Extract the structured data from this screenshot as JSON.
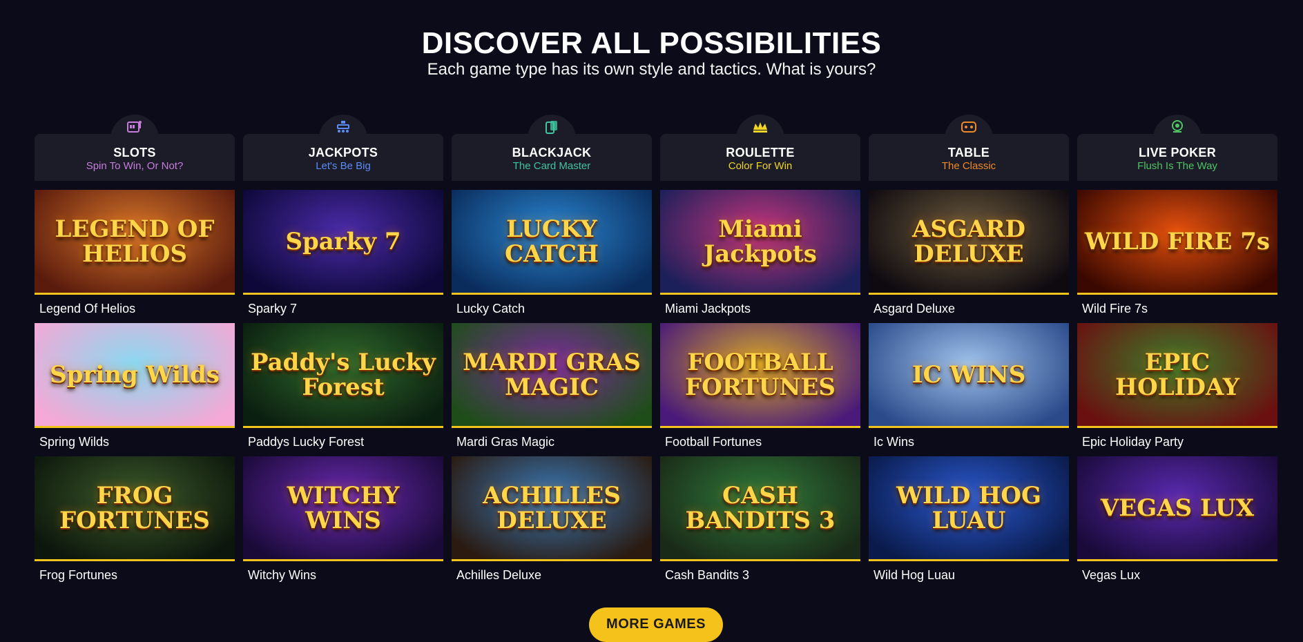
{
  "hero": {
    "title": "DISCOVER ALL POSSIBILITIES",
    "subtitle": "Each game type has its own style and tactics. What is yours?"
  },
  "categories": [
    {
      "title": "SLOTS",
      "subtitle": "Spin To Win, Or Not?",
      "icon": "slot-machine-icon",
      "color": "#c77ddc"
    },
    {
      "title": "JACKPOTS",
      "subtitle": "Let's Be Big",
      "icon": "jackpot-icon",
      "color": "#5b8cf5"
    },
    {
      "title": "BLACKJACK",
      "subtitle": "The Card Master",
      "icon": "cards-icon",
      "color": "#3fc5a0"
    },
    {
      "title": "ROULETTE",
      "subtitle": "Color For Win",
      "icon": "crown-icon",
      "color": "#f1d524"
    },
    {
      "title": "TABLE",
      "subtitle": "The Classic",
      "icon": "table-icon",
      "color": "#f08a24"
    },
    {
      "title": "LIVE POKER",
      "subtitle": "Flush Is The Way",
      "icon": "webcam-icon",
      "color": "#4ec463"
    }
  ],
  "games": [
    {
      "name": "Legend Of Helios",
      "logo": "LEGEND OF HELIOS",
      "bg": [
        "#d7762a",
        "#5a1b0d"
      ]
    },
    {
      "name": "Sparky 7",
      "logo": "Sparky 7",
      "bg": [
        "#4a2ba8",
        "#0d0838"
      ]
    },
    {
      "name": "Lucky Catch",
      "logo": "LUCKY CATCH",
      "bg": [
        "#2a86d0",
        "#0a2c5c"
      ]
    },
    {
      "name": "Miami Jackpots",
      "logo": "Miami Jackpots",
      "bg": [
        "#c2357b",
        "#1b1f5a"
      ]
    },
    {
      "name": "Asgard Deluxe",
      "logo": "ASGARD DELUXE",
      "bg": [
        "#6c5a3c",
        "#0e0a10"
      ]
    },
    {
      "name": "Wild Fire 7s",
      "logo": "WILD FIRE 7s",
      "bg": [
        "#e4500e",
        "#3a0800"
      ]
    },
    {
      "name": "Spring Wilds",
      "logo": "Spring Wilds",
      "bg": [
        "#8ad8f0",
        "#f4a9d6"
      ]
    },
    {
      "name": "Paddys Lucky Forest",
      "logo": "Paddy's Lucky Forest",
      "bg": [
        "#2f6a2c",
        "#0b1f10"
      ]
    },
    {
      "name": "Mardi Gras Magic",
      "logo": "MARDI GRAS MAGIC",
      "bg": [
        "#7a2d9c",
        "#1f4d1a"
      ]
    },
    {
      "name": "Football Fortunes",
      "logo": "FOOTBALL FORTUNES",
      "bg": [
        "#d6a82a",
        "#4a1a7a"
      ]
    },
    {
      "name": "Ic Wins",
      "logo": "IC WINS",
      "bg": [
        "#9fc3ec",
        "#2a4a8a"
      ]
    },
    {
      "name": "Epic Holiday Party",
      "logo": "EPIC HOLIDAY",
      "bg": [
        "#3d7d2a",
        "#6a1010"
      ]
    },
    {
      "name": "Frog Fortunes",
      "logo": "FROG FORTUNES",
      "bg": [
        "#3c5a2a",
        "#0c160c"
      ]
    },
    {
      "name": "Witchy Wins",
      "logo": "WITCHY WINS",
      "bg": [
        "#6a2ab0",
        "#1a0a38"
      ]
    },
    {
      "name": "Achilles Deluxe",
      "logo": "ACHILLES DELUXE",
      "bg": [
        "#3a7ab8",
        "#2a1a10"
      ]
    },
    {
      "name": "Cash Bandits 3",
      "logo": "CASH BANDITS 3",
      "bg": [
        "#2f7a3a",
        "#1a2a18"
      ]
    },
    {
      "name": "Wild Hog Luau",
      "logo": "WILD HOG LUAU",
      "bg": [
        "#2a5ad0",
        "#0a1a4a"
      ]
    },
    {
      "name": "Vegas Lux",
      "logo": "VEGAS LUX",
      "bg": [
        "#5a2ab0",
        "#1a0a3a"
      ]
    }
  ],
  "more_button": {
    "label": "MORE GAMES"
  },
  "accent_color": "#f5c11b"
}
